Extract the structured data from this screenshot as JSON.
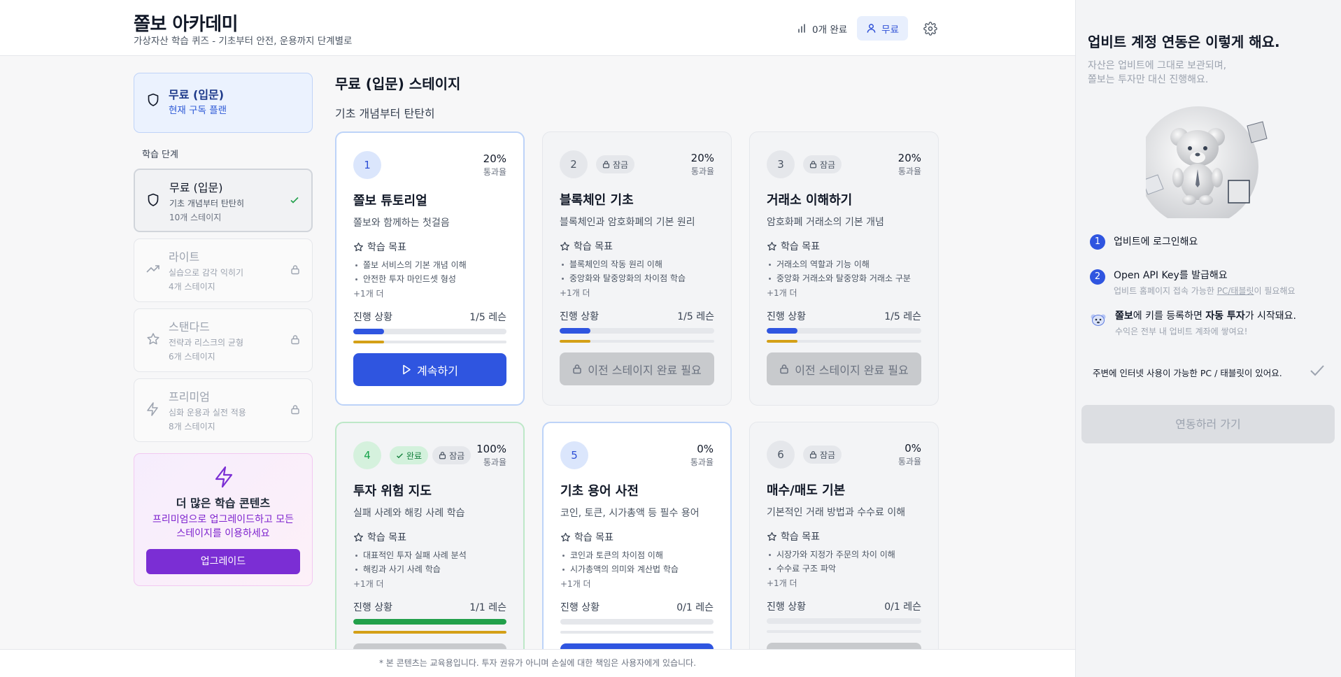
{
  "header": {
    "title": "쫄보 아카데미",
    "subtitle": "가상자산 학습 퀴즈 - 기초부터 안전, 운용까지 단계별로",
    "completed": "0개 완료",
    "plan_button": "무료"
  },
  "sidebar": {
    "current_plan": {
      "name": "무료 (입문)",
      "caption": "현재 구독 플랜"
    },
    "steps_label": "학습 단계",
    "steps": [
      {
        "name": "무료 (입문)",
        "desc": "기초 개념부터 탄탄히",
        "count": "10개 스테이지"
      },
      {
        "name": "라이트",
        "desc": "실습으로 감각 익히기",
        "count": "4개 스테이지"
      },
      {
        "name": "스탠다드",
        "desc": "전략과 리스크의 균형",
        "count": "6개 스테이지"
      },
      {
        "name": "프리미엄",
        "desc": "심화 운용과 실전 적용",
        "count": "8개 스테이지"
      }
    ],
    "promo": {
      "title": "더 많은 학습 콘텐츠",
      "desc": "프리미엄으로 업그레이드하고 모든 스테이지를 이용하세요",
      "button": "업그레이드"
    }
  },
  "content": {
    "title": "무료 (입문) 스테이지",
    "subtitle": "기초 개념부터 탄탄히",
    "labels": {
      "goal": "학습 목표",
      "progress": "진행 상황",
      "pass_rate": "통과율",
      "locked": "잠금",
      "completed": "완료",
      "more": "+1개 더"
    },
    "cards": [
      {
        "num": "1",
        "pct": "20%",
        "title": "쫄보 튜토리얼",
        "desc": "쫄보와 함께하는 첫걸음",
        "goals": [
          "쫄보 서비스의 기본 개념 이해",
          "안전한 투자 마인드셋 형성"
        ],
        "lessons": "1/5 레슨",
        "progress": 0.2,
        "button": "계속하기"
      },
      {
        "num": "2",
        "pct": "20%",
        "title": "블록체인 기초",
        "desc": "블록체인과 암호화폐의 기본 원리",
        "goals": [
          "블록체인의 작동 원리 이해",
          "중앙화와 탈중앙화의 차이점 학습"
        ],
        "lessons": "1/5 레슨",
        "progress": 0.2,
        "button": "이전 스테이지 완료 필요"
      },
      {
        "num": "3",
        "pct": "20%",
        "title": "거래소 이해하기",
        "desc": "암호화폐 거래소의 기본 개념",
        "goals": [
          "거래소의 역할과 기능 이해",
          "중앙화 거래소와 탈중앙화 거래소 구분"
        ],
        "lessons": "1/5 레슨",
        "progress": 0.2,
        "button": "이전 스테이지 완료 필요"
      },
      {
        "num": "4",
        "pct": "100%",
        "title": "투자 위험 지도",
        "desc": "실패 사례와 해킹 사례 학습",
        "goals": [
          "대표적인 투자 실패 사례 분석",
          "해킹과 사기 사례 학습"
        ],
        "lessons": "1/1 레슨",
        "progress": 1.0
      },
      {
        "num": "5",
        "pct": "0%",
        "title": "기초 용어 사전",
        "desc": "코인, 토큰, 시가총액 등 필수 용어",
        "goals": [
          "코인과 토큰의 차이점 이해",
          "시가총액의 의미와 계산법 학습"
        ],
        "lessons": "0/1 레슨",
        "progress": 0
      },
      {
        "num": "6",
        "pct": "0%",
        "title": "매수/매도 기본",
        "desc": "기본적인 거래 방법과 수수료 이해",
        "goals": [
          "시장가와 지정가 주문의 차이 이해",
          "수수료 구조 파악"
        ],
        "lessons": "0/1 레슨",
        "progress": 0
      }
    ]
  },
  "footer": {
    "disclaimer": "* 본 콘텐츠는 교육용입니다. 투자 권유가 아니며 손실에 대한 책임은 사용자에게 있습니다."
  },
  "panel": {
    "title": "업비트 계정 연동은 이렇게 해요.",
    "subtitle_1": "자산은 업비트에 그대로 보관되며,",
    "subtitle_2": "쫄보는 투자만 대신 진행해요.",
    "step1": "업비트에 로그인해요",
    "step2": "Open API Key를 발급해요",
    "step2_desc_a": "업비트 홈페이지 접속 가능한 ",
    "step2_desc_link": "PC/태블릿",
    "step2_desc_b": "이 필요해요",
    "step3_a": "쫄보",
    "step3_b": "에 키를 등록하면 ",
    "step3_c": "자동 투자",
    "step3_d": "가 시작돼요.",
    "step3_desc": "수익은 전부 내 업비트 계좌에 쌓여요!",
    "checkbox": "주변에 인터넷 사용이 가능한 PC / 태블릿이 있어요.",
    "button": "연동하러 가기"
  },
  "colors": {
    "accent": "#2f55e0",
    "success": "#22a04b",
    "warning": "#d4a017",
    "premium": "#7b2ed4"
  }
}
